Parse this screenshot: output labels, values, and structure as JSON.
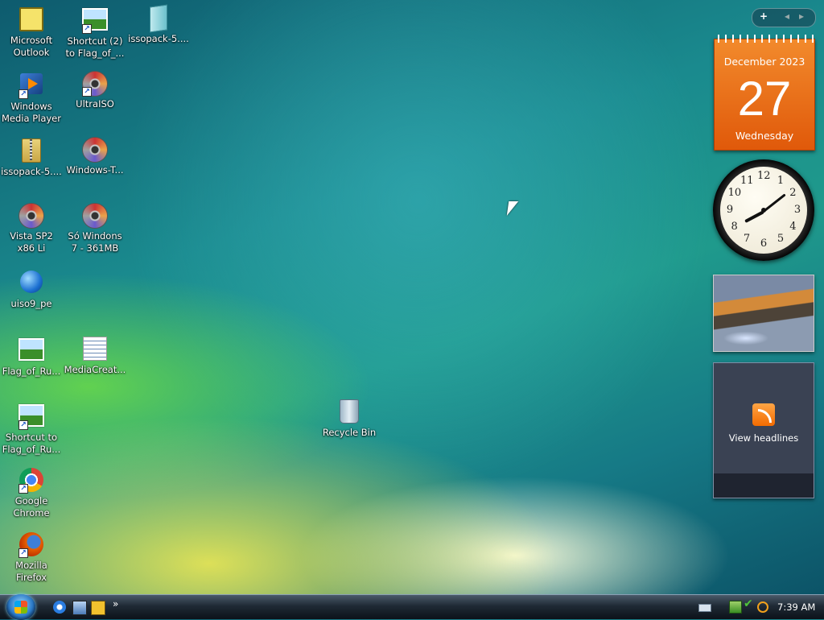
{
  "desktop": {
    "icons": [
      {
        "label": "Microsoft Outlook",
        "icon": "outlook-icon"
      },
      {
        "label": "Shortcut (2) to Flag_of_...",
        "icon": "image-shortcut-icon"
      },
      {
        "label": "issopack-5....",
        "icon": "zip-archive-icon"
      },
      {
        "label": "Windows Media Player",
        "icon": "media-player-icon"
      },
      {
        "label": "UltraISO",
        "icon": "disc-icon"
      },
      {
        "label": "issopack-5....",
        "icon": "zipped-folder-icon"
      },
      {
        "label": "Windows-T...",
        "icon": "disc-icon"
      },
      {
        "label": "Vista SP2 x86 Li",
        "icon": "disc-icon"
      },
      {
        "label": "Só Windons 7 - 361MB",
        "icon": "disc-icon"
      },
      {
        "label": "uiso9_pe",
        "icon": "installer-icon"
      },
      {
        "label": "Flag_of_Ru...",
        "icon": "image-icon"
      },
      {
        "label": "MediaCreat...",
        "icon": "document-icon"
      },
      {
        "label": "Shortcut to Flag_of_Ru...",
        "icon": "image-shortcut-icon"
      },
      {
        "label": "Google Chrome",
        "icon": "chrome-icon"
      },
      {
        "label": "Mozilla Firefox",
        "icon": "firefox-icon"
      },
      {
        "label": "Recycle Bin",
        "icon": "recycle-bin-icon"
      }
    ]
  },
  "sidebar": {
    "add_gadget": "+",
    "prev": "◂",
    "next": "▸",
    "calendar": {
      "month_year": "December 2023",
      "day": "27",
      "weekday": "Wednesday"
    },
    "clock": {
      "numbers": [
        "12",
        "1",
        "2",
        "3",
        "4",
        "5",
        "6",
        "7",
        "8",
        "9",
        "10",
        "11"
      ]
    },
    "slideshow": {
      "icon": "photo-slideshow"
    },
    "feed": {
      "label": "View headlines",
      "icon": "rss-icon"
    }
  },
  "taskbar": {
    "start_icon": "windows-start-orb",
    "quicklaunch": [
      "internet-explorer-icon",
      "show-desktop-icon",
      "media-player-icon"
    ],
    "more": "»",
    "tray": [
      "keyboard-icon",
      "network-icon",
      "check-icon",
      "search-icon"
    ],
    "time": "7:39 AM"
  },
  "colors": {
    "calendar_orange": "#e0590a",
    "taskbar_dark": "#1f2a35"
  }
}
